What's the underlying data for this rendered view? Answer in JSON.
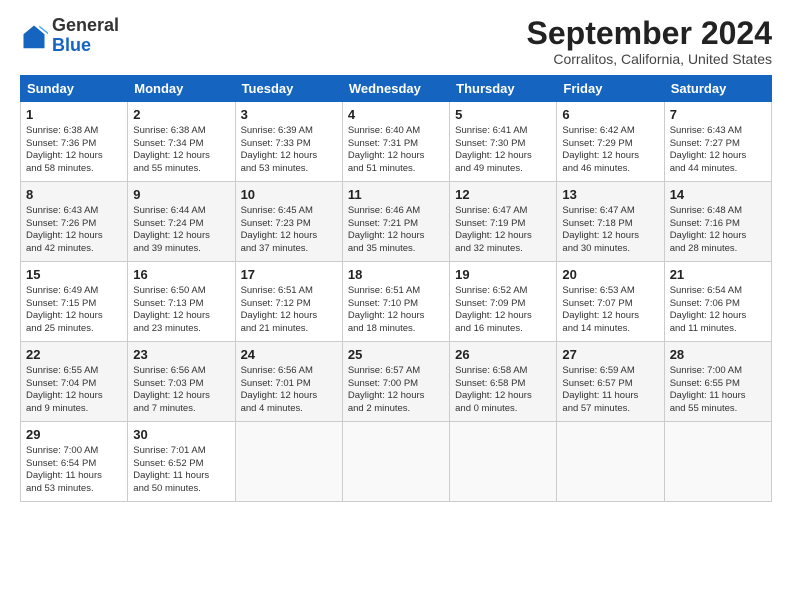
{
  "header": {
    "logo_general": "General",
    "logo_blue": "Blue",
    "month": "September 2024",
    "location": "Corralitos, California, United States"
  },
  "weekdays": [
    "Sunday",
    "Monday",
    "Tuesday",
    "Wednesday",
    "Thursday",
    "Friday",
    "Saturday"
  ],
  "weeks": [
    [
      {
        "day": "1",
        "info": "Sunrise: 6:38 AM\nSunset: 7:36 PM\nDaylight: 12 hours\nand 58 minutes."
      },
      {
        "day": "2",
        "info": "Sunrise: 6:38 AM\nSunset: 7:34 PM\nDaylight: 12 hours\nand 55 minutes."
      },
      {
        "day": "3",
        "info": "Sunrise: 6:39 AM\nSunset: 7:33 PM\nDaylight: 12 hours\nand 53 minutes."
      },
      {
        "day": "4",
        "info": "Sunrise: 6:40 AM\nSunset: 7:31 PM\nDaylight: 12 hours\nand 51 minutes."
      },
      {
        "day": "5",
        "info": "Sunrise: 6:41 AM\nSunset: 7:30 PM\nDaylight: 12 hours\nand 49 minutes."
      },
      {
        "day": "6",
        "info": "Sunrise: 6:42 AM\nSunset: 7:29 PM\nDaylight: 12 hours\nand 46 minutes."
      },
      {
        "day": "7",
        "info": "Sunrise: 6:43 AM\nSunset: 7:27 PM\nDaylight: 12 hours\nand 44 minutes."
      }
    ],
    [
      {
        "day": "8",
        "info": "Sunrise: 6:43 AM\nSunset: 7:26 PM\nDaylight: 12 hours\nand 42 minutes."
      },
      {
        "day": "9",
        "info": "Sunrise: 6:44 AM\nSunset: 7:24 PM\nDaylight: 12 hours\nand 39 minutes."
      },
      {
        "day": "10",
        "info": "Sunrise: 6:45 AM\nSunset: 7:23 PM\nDaylight: 12 hours\nand 37 minutes."
      },
      {
        "day": "11",
        "info": "Sunrise: 6:46 AM\nSunset: 7:21 PM\nDaylight: 12 hours\nand 35 minutes."
      },
      {
        "day": "12",
        "info": "Sunrise: 6:47 AM\nSunset: 7:19 PM\nDaylight: 12 hours\nand 32 minutes."
      },
      {
        "day": "13",
        "info": "Sunrise: 6:47 AM\nSunset: 7:18 PM\nDaylight: 12 hours\nand 30 minutes."
      },
      {
        "day": "14",
        "info": "Sunrise: 6:48 AM\nSunset: 7:16 PM\nDaylight: 12 hours\nand 28 minutes."
      }
    ],
    [
      {
        "day": "15",
        "info": "Sunrise: 6:49 AM\nSunset: 7:15 PM\nDaylight: 12 hours\nand 25 minutes."
      },
      {
        "day": "16",
        "info": "Sunrise: 6:50 AM\nSunset: 7:13 PM\nDaylight: 12 hours\nand 23 minutes."
      },
      {
        "day": "17",
        "info": "Sunrise: 6:51 AM\nSunset: 7:12 PM\nDaylight: 12 hours\nand 21 minutes."
      },
      {
        "day": "18",
        "info": "Sunrise: 6:51 AM\nSunset: 7:10 PM\nDaylight: 12 hours\nand 18 minutes."
      },
      {
        "day": "19",
        "info": "Sunrise: 6:52 AM\nSunset: 7:09 PM\nDaylight: 12 hours\nand 16 minutes."
      },
      {
        "day": "20",
        "info": "Sunrise: 6:53 AM\nSunset: 7:07 PM\nDaylight: 12 hours\nand 14 minutes."
      },
      {
        "day": "21",
        "info": "Sunrise: 6:54 AM\nSunset: 7:06 PM\nDaylight: 12 hours\nand 11 minutes."
      }
    ],
    [
      {
        "day": "22",
        "info": "Sunrise: 6:55 AM\nSunset: 7:04 PM\nDaylight: 12 hours\nand 9 minutes."
      },
      {
        "day": "23",
        "info": "Sunrise: 6:56 AM\nSunset: 7:03 PM\nDaylight: 12 hours\nand 7 minutes."
      },
      {
        "day": "24",
        "info": "Sunrise: 6:56 AM\nSunset: 7:01 PM\nDaylight: 12 hours\nand 4 minutes."
      },
      {
        "day": "25",
        "info": "Sunrise: 6:57 AM\nSunset: 7:00 PM\nDaylight: 12 hours\nand 2 minutes."
      },
      {
        "day": "26",
        "info": "Sunrise: 6:58 AM\nSunset: 6:58 PM\nDaylight: 12 hours\nand 0 minutes."
      },
      {
        "day": "27",
        "info": "Sunrise: 6:59 AM\nSunset: 6:57 PM\nDaylight: 11 hours\nand 57 minutes."
      },
      {
        "day": "28",
        "info": "Sunrise: 7:00 AM\nSunset: 6:55 PM\nDaylight: 11 hours\nand 55 minutes."
      }
    ],
    [
      {
        "day": "29",
        "info": "Sunrise: 7:00 AM\nSunset: 6:54 PM\nDaylight: 11 hours\nand 53 minutes."
      },
      {
        "day": "30",
        "info": "Sunrise: 7:01 AM\nSunset: 6:52 PM\nDaylight: 11 hours\nand 50 minutes."
      },
      {
        "day": "",
        "info": ""
      },
      {
        "day": "",
        "info": ""
      },
      {
        "day": "",
        "info": ""
      },
      {
        "day": "",
        "info": ""
      },
      {
        "day": "",
        "info": ""
      }
    ]
  ]
}
